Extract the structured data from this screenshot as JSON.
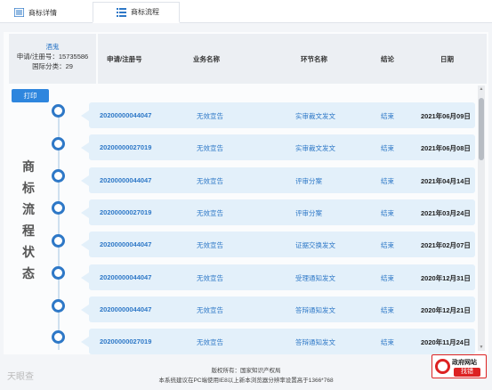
{
  "tabs": [
    {
      "label": "商标详情",
      "icon": "list-icon"
    },
    {
      "label": "商标流程",
      "icon": "flow-list-icon"
    }
  ],
  "mark": {
    "name": "酒鬼",
    "reg_line": "申请/注册号：15735586",
    "class_line": "国际分类：29"
  },
  "columns": [
    "申请/注册号",
    "业务名称",
    "环节名称",
    "结论",
    "日期"
  ],
  "print_label": "打印",
  "side_title": [
    "商",
    "标",
    "流",
    "程",
    "状",
    "态"
  ],
  "rows": [
    {
      "reg_no": "20200000044047",
      "business": "无效宣告",
      "step": "实审裁文发文",
      "result": "结束",
      "date": "2021年06月09日"
    },
    {
      "reg_no": "20200000027019",
      "business": "无效宣告",
      "step": "实审裁文发文",
      "result": "结束",
      "date": "2021年06月08日"
    },
    {
      "reg_no": "20200000044047",
      "business": "无效宣告",
      "step": "评审分案",
      "result": "结束",
      "date": "2021年04月14日"
    },
    {
      "reg_no": "20200000027019",
      "business": "无效宣告",
      "step": "评审分案",
      "result": "结束",
      "date": "2021年03月24日"
    },
    {
      "reg_no": "20200000044047",
      "business": "无效宣告",
      "step": "证据交换发文",
      "result": "结束",
      "date": "2021年02月07日"
    },
    {
      "reg_no": "20200000044047",
      "business": "无效宣告",
      "step": "受理通知发文",
      "result": "结束",
      "date": "2020年12月31日"
    },
    {
      "reg_no": "20200000044047",
      "business": "无效宣告",
      "step": "答辩通知发文",
      "result": "结束",
      "date": "2020年12月21日"
    },
    {
      "reg_no": "20200000027019",
      "business": "无效宣告",
      "step": "答辩通知发文",
      "result": "结束",
      "date": "2020年11月24日"
    }
  ],
  "footer": {
    "copyright": "版权所有：国家知识产权局",
    "browser_note": "本系统建议在PC端使用IE8以上新本浏览器分辨率设置高于1366*768"
  },
  "badge": {
    "title": "政府网站",
    "action": "找错"
  },
  "watermark": "天眼查",
  "colors": {
    "accent": "#2e78c7",
    "row_bg": "#e3f0fa",
    "badge_red": "#d22222"
  }
}
